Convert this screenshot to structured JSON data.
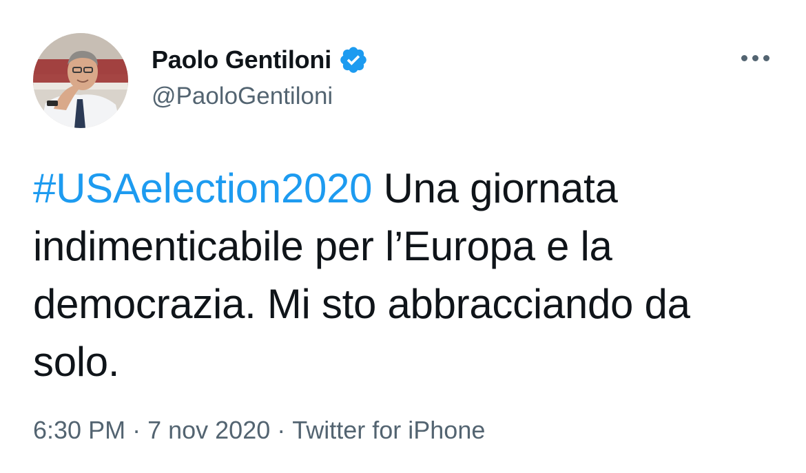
{
  "author": {
    "display_name": "Paolo Gentiloni",
    "handle": "@PaoloGentiloni",
    "verified": true,
    "avatar_icon": "profile-photo"
  },
  "tweet": {
    "hashtag": "#USAelection2020",
    "text": " Una giornata indimenticabile per l’Europa e la democrazia. Mi sto abbracciando da solo."
  },
  "meta": {
    "time": "6:30 PM",
    "separator": "·",
    "date": "7 nov 2020",
    "source": "Twitter for iPhone"
  },
  "icons": {
    "verified": "verified-badge-icon",
    "more": "more-options-icon"
  },
  "colors": {
    "link": "#1d9bf0",
    "verified": "#1d9bf0",
    "secondary_text": "#536471",
    "primary_text": "#0f1419"
  }
}
